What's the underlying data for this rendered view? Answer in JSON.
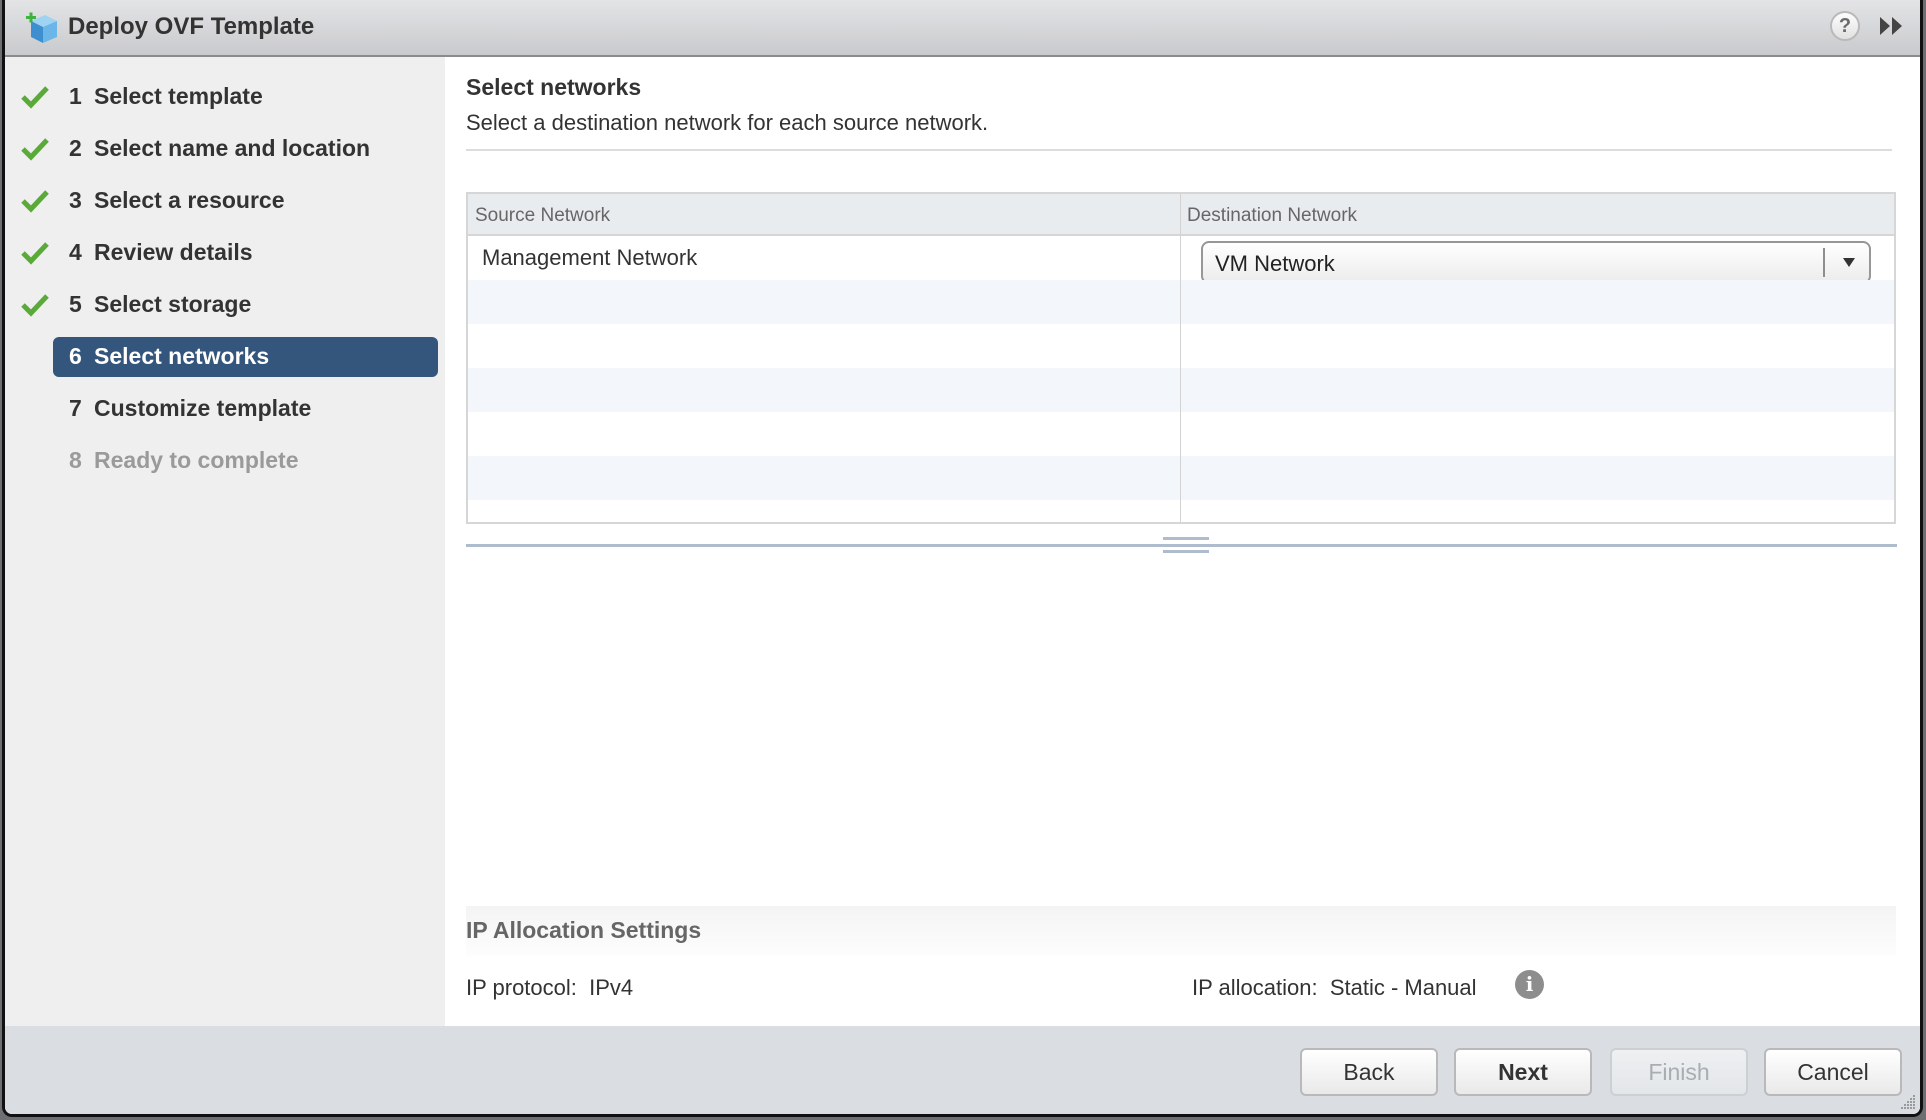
{
  "window": {
    "title": "Deploy OVF Template",
    "help_label": "?",
    "icons": {
      "app": "ovf-deploy-icon",
      "help": "help-icon",
      "expand": "double-chevron-right-icon"
    }
  },
  "wizard": {
    "steps": [
      {
        "number": "1",
        "label": "Select template",
        "state": "done"
      },
      {
        "number": "2",
        "label": "Select name and location",
        "state": "done"
      },
      {
        "number": "3",
        "label": "Select a resource",
        "state": "done"
      },
      {
        "number": "4",
        "label": "Review details",
        "state": "done"
      },
      {
        "number": "5",
        "label": "Select storage",
        "state": "done"
      },
      {
        "number": "6",
        "label": "Select networks",
        "state": "active"
      },
      {
        "number": "7",
        "label": "Customize template",
        "state": "todo"
      },
      {
        "number": "8",
        "label": "Ready to complete",
        "state": "disabled"
      }
    ]
  },
  "page": {
    "title": "Select networks",
    "subtitle": "Select a destination network for each source network."
  },
  "network_table": {
    "columns": [
      "Source Network",
      "Destination Network"
    ],
    "rows": [
      {
        "source": "Management Network",
        "destination": "VM Network"
      }
    ]
  },
  "ip_settings": {
    "title": "IP Allocation Settings",
    "protocol_label": "IP protocol:",
    "protocol_value": "IPv4",
    "allocation_label": "IP allocation:",
    "allocation_value": "Static - Manual",
    "info_glyph": "i"
  },
  "footer": {
    "back": "Back",
    "next": "Next",
    "finish": "Finish",
    "cancel": "Cancel"
  },
  "colors": {
    "active_step": "#34557c",
    "check": "#5aaa3a",
    "splitter": "#aebccd"
  }
}
